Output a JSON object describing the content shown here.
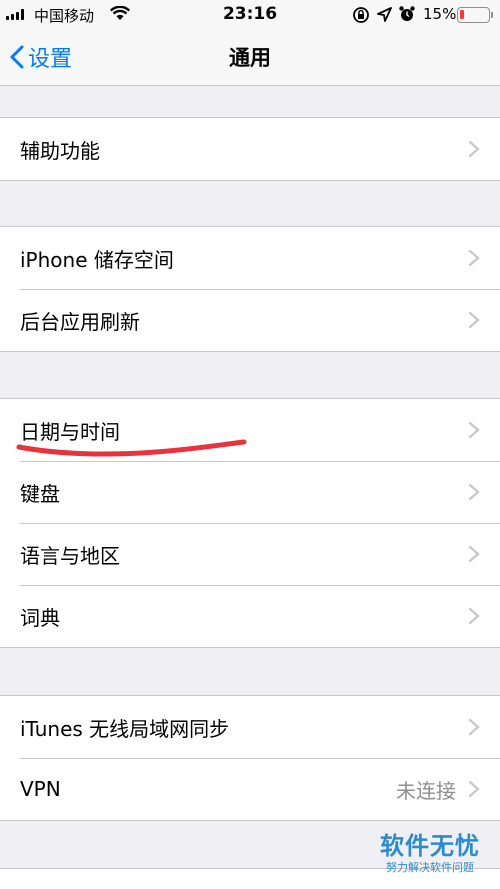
{
  "status_bar": {
    "carrier": "中国移动",
    "time": "23:16",
    "battery_percent": "15%",
    "battery_level": 0.15,
    "battery_color": "#ff3b30",
    "icons": [
      "signal-icon",
      "wifi-icon",
      "rotation-lock-icon",
      "location-icon",
      "alarm-icon",
      "battery-icon"
    ]
  },
  "nav": {
    "back_label": "设置",
    "title": "通用",
    "accent_color": "#007aff"
  },
  "groups": [
    {
      "rows": [
        {
          "label": "辅助功能"
        }
      ]
    },
    {
      "rows": [
        {
          "label": "iPhone 储存空间"
        },
        {
          "label": "后台应用刷新"
        }
      ]
    },
    {
      "rows": [
        {
          "label": "日期与时间",
          "annotated": true
        },
        {
          "label": "键盘"
        },
        {
          "label": "语言与地区"
        },
        {
          "label": "词典"
        }
      ]
    },
    {
      "rows": [
        {
          "label": "iTunes 无线局域网同步"
        },
        {
          "label": "VPN",
          "detail": "未连接"
        }
      ]
    }
  ],
  "watermark": {
    "title": "软件无忧",
    "subtitle": "努力解决软件问题"
  }
}
